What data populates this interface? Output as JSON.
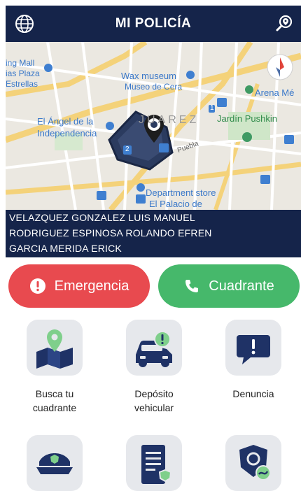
{
  "header": {
    "title": "MI POLICÍA",
    "globe_icon": "globe-icon",
    "search_icon": "location-search-icon"
  },
  "map": {
    "labels": {
      "mall_1": "ing Mall",
      "mall_2": "ias Plaza",
      "mall_3": "Estrellas",
      "wax_1": "Wax museum",
      "wax_2": "Museo de Cera",
      "arena": "Arena Mé",
      "angel_1": "El Ángel de la",
      "angel_2": "Independencia",
      "juarez": "JUAREZ",
      "pushkin": "Jardín Pushkin",
      "puebla": "Puebla",
      "dept_1": "Department store",
      "dept_2": "El Palacio de",
      "badge_2": "2",
      "badge_1": "1"
    },
    "metro_label": "M"
  },
  "officers": [
    "VELAZQUEZ GONZALEZ LUIS MANUEL",
    "RODRIGUEZ ESPINOSA ROLANDO EFREN",
    "GARCIA MERIDA ERICK"
  ],
  "buttons": {
    "emergency": "Emergencia",
    "quadrant": "Cuadrante"
  },
  "grid": [
    {
      "label_1": "Busca tu",
      "label_2": "cuadrante",
      "icon": "map-pin-icon"
    },
    {
      "label_1": "Depósito",
      "label_2": "vehicular",
      "icon": "car-alert-icon"
    },
    {
      "label_1": "Denuncia",
      "label_2": "",
      "icon": "report-bubble-icon"
    }
  ],
  "grid_row2_icons": [
    "police-cap-icon",
    "document-shield-icon",
    "shield-gear-icon"
  ],
  "colors": {
    "navy": "#15244a",
    "red": "#e84a4f",
    "green": "#46b86b",
    "tile": "#e6e8ec"
  }
}
